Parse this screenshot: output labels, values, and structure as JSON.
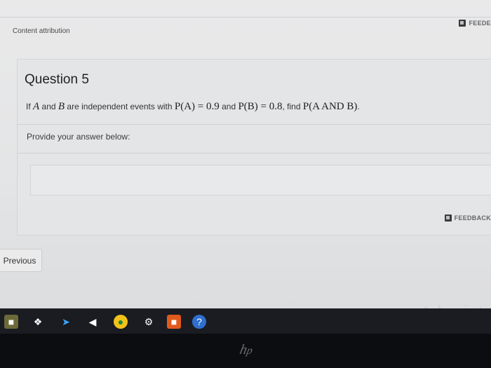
{
  "header": {
    "feedback_label": "FEEDE"
  },
  "attribution": "Content attribution",
  "question": {
    "title": "Question 5",
    "text_prefix": "If",
    "var_a": "A",
    "and_word": "and",
    "var_b": "B",
    "text_mid": "are independent events with",
    "pa_expr": "P(A) = 0.9",
    "and_word2": "and",
    "pb_expr": "P(B) = 0.8",
    "find_word": ", find",
    "target_expr": "P(A AND B)",
    "end": "."
  },
  "answer": {
    "prompt": "Provide your answer below:",
    "value": ""
  },
  "feedback_label": "FEEDBACK",
  "nav": {
    "previous_label": "Previous"
  },
  "taskbar": {
    "icons": [
      "store-icon",
      "dropbox-icon",
      "bolt-icon",
      "kindle-icon",
      "chrome-icon",
      "gear-icon",
      "office-icon",
      "help-icon"
    ]
  },
  "colors": {
    "taskbar": "#1a1c22",
    "help_icon": "#2f6fcf",
    "chrome_yellow": "#f3c21a",
    "office_orange": "#e05a1e"
  },
  "brand_mark": "hp"
}
